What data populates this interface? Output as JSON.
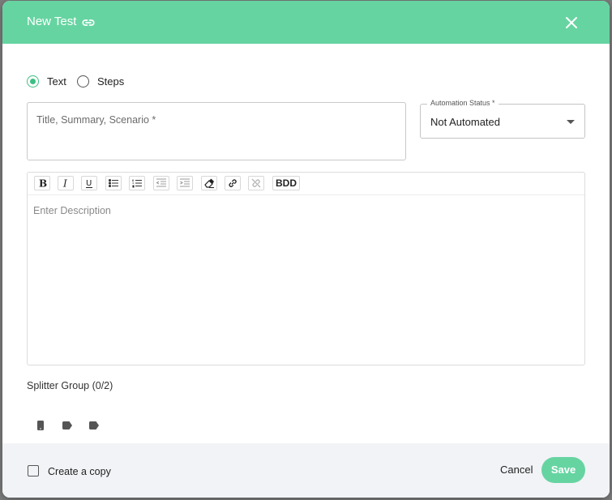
{
  "dialog": {
    "title": "New Test",
    "link_icon": "link-icon",
    "close_icon": "close-icon"
  },
  "mode": {
    "options": [
      {
        "label": "Text",
        "selected": true
      },
      {
        "label": "Steps",
        "selected": false
      }
    ]
  },
  "title_field": {
    "placeholder": "Title, Summary, Scenario *"
  },
  "automation_status": {
    "label": "Automation Status *",
    "value": "Not Automated"
  },
  "editor": {
    "toolbar": [
      {
        "name": "bold-icon"
      },
      {
        "name": "italic-icon"
      },
      {
        "name": "underline-icon"
      },
      {
        "name": "bulleted-list-icon"
      },
      {
        "name": "numbered-list-icon"
      },
      {
        "name": "outdent-icon"
      },
      {
        "name": "indent-icon"
      },
      {
        "name": "eraser-icon"
      },
      {
        "name": "link-icon"
      },
      {
        "name": "unlink-icon"
      }
    ],
    "bdd_label": "BDD",
    "placeholder": "Enter Description"
  },
  "splitter": {
    "label": "Splitter Group (0/2)",
    "icons": [
      "mobile-icon",
      "tag-icon",
      "tag-icon"
    ]
  },
  "footer": {
    "create_copy_label": "Create a copy",
    "cancel_label": "Cancel",
    "save_label": "Save"
  },
  "colors": {
    "accent": "#66d4a1",
    "radio_selected": "#3dbf83",
    "footer_bg": "#f1f3f6"
  }
}
